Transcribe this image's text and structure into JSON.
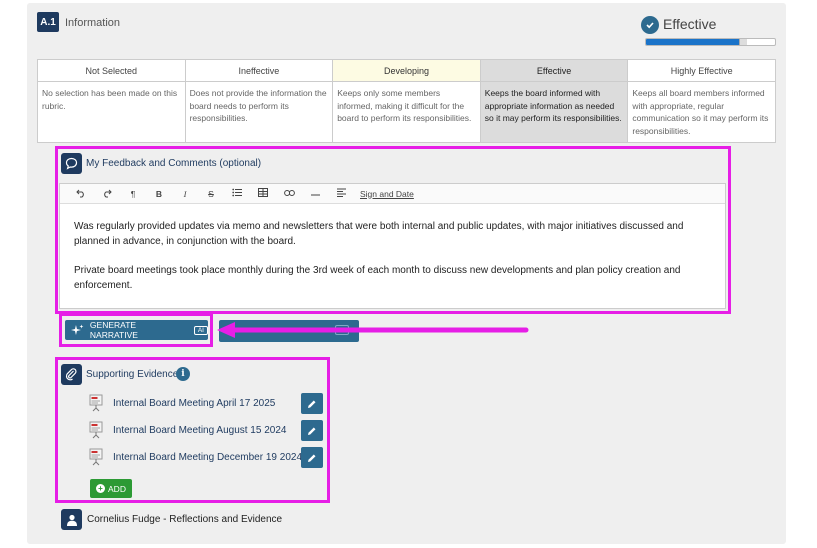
{
  "section": {
    "badge": "A.1",
    "title": "Information"
  },
  "rating": {
    "label": "Effective",
    "progress_fraction": 0.75
  },
  "rubric": {
    "headers": [
      "Not Selected",
      "Ineffective",
      "Developing",
      "Effective",
      "Highly Effective"
    ],
    "descriptions": [
      "No selection has been made on this rubric.",
      "Does not provide the information the board needs to perform its responsibilities.",
      "Keeps only some members informed, making it difficult for the board to perform its responsibilities.",
      "Keeps the board informed with appropriate information as needed so it may perform its responsibilities.",
      "Keeps all board members informed with appropriate, regular communication so it may perform its responsibilities."
    ]
  },
  "feedback": {
    "title": "My Feedback and Comments (optional)",
    "toolbar": {
      "bold": "B",
      "italic": "I",
      "strike": "S",
      "sign": "Sign and Date"
    },
    "paragraphs": [
      "Was regularly provided updates via memo and newsletters that were both internal and public updates, with major initiatives discussed and planned in advance, in conjunction with the board.",
      "Private board meetings took place monthly during the 3rd week of each month to discuss new developments and plan policy creation and enforcement."
    ]
  },
  "actions": {
    "generate_label": "GENERATE NARRATIVE",
    "ai_tag": "AI"
  },
  "evidence": {
    "title": "Supporting Evidence",
    "info_glyph": "i",
    "items": [
      "Internal Board Meeting April 17 2025",
      "Internal Board Meeting August 15 2024",
      "Internal Board Meeting December 19 2024"
    ],
    "add_label": "ADD"
  },
  "reflections": {
    "label": "Cornelius Fudge - Reflections and Evidence"
  },
  "colors": {
    "navy": "#1e3a5f",
    "teal_button": "#2d6a8f",
    "highlight": "#e61ee6",
    "add_green": "#2c9a34",
    "progress": "#1a73c9"
  }
}
